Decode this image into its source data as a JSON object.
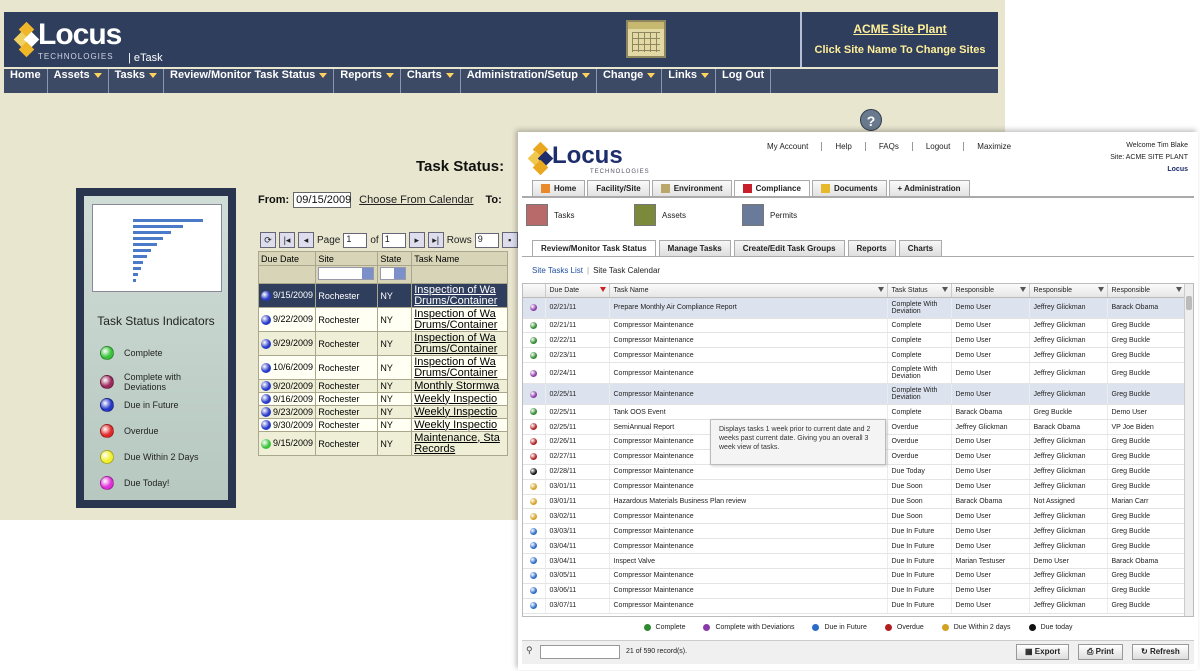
{
  "old_app": {
    "logo_text": "Locus",
    "logo_sub": "TECHNOLOGIES",
    "product": "| eTask",
    "site": {
      "name": "ACME Site Plant",
      "change_label": "Click Site Name To Change Sites"
    },
    "nav": [
      {
        "label": "Home",
        "dropdown": false
      },
      {
        "label": "Assets",
        "dropdown": true
      },
      {
        "label": "Tasks",
        "dropdown": true
      },
      {
        "label": "Review/Monitor Task Status",
        "dropdown": true
      },
      {
        "label": "Reports",
        "dropdown": true
      },
      {
        "label": "Charts",
        "dropdown": true
      },
      {
        "label": "Administration/Setup",
        "dropdown": true
      },
      {
        "label": "Change",
        "dropdown": true
      },
      {
        "label": "Links",
        "dropdown": true
      },
      {
        "label": "Log Out",
        "dropdown": false
      }
    ],
    "help_label": "?",
    "page_title": "Task Status:",
    "from_label": "From:",
    "from_value": "09/15/2009",
    "calendar_link": "Choose From Calendar",
    "to_label": "To:",
    "legend": {
      "title": "Task Status Indicators",
      "items": [
        {
          "label": "Complete",
          "color": "#39c23a"
        },
        {
          "label": "Complete with Deviations",
          "color": "#9c2a5c"
        },
        {
          "label": "Due in Future",
          "color": "#2638c8"
        },
        {
          "label": "Overdue",
          "color": "#e02a2a"
        },
        {
          "label": "Due Within 2 Days",
          "color": "#f0f02a"
        },
        {
          "label": "Due Today!",
          "color": "#e030d8"
        }
      ]
    },
    "pager": {
      "page_label": "Page",
      "page_value": "1",
      "of_label": "of",
      "of_value": "1",
      "rows_label": "Rows",
      "rows_value": "9"
    },
    "columns": [
      "Due Date",
      "Site",
      "State",
      "Task Name"
    ],
    "rows": [
      {
        "date": "9/15/2009",
        "site": "Rochester",
        "state": "NY",
        "task": [
          "Inspection of Wa",
          "Drums/Container"
        ],
        "color": "#2638c8"
      },
      {
        "date": "9/22/2009",
        "site": "Rochester",
        "state": "NY",
        "task": [
          "Inspection of Wa",
          "Drums/Container"
        ],
        "color": "#2638c8"
      },
      {
        "date": "9/29/2009",
        "site": "Rochester",
        "state": "NY",
        "task": [
          "Inspection of Wa",
          "Drums/Container"
        ],
        "color": "#2638c8"
      },
      {
        "date": "10/6/2009",
        "site": "Rochester",
        "state": "NY",
        "task": [
          "Inspection of Wa",
          "Drums/Container"
        ],
        "color": "#2638c8"
      },
      {
        "date": "9/20/2009",
        "site": "Rochester",
        "state": "NY",
        "task": [
          "Monthly Stormwa"
        ],
        "color": "#2638c8"
      },
      {
        "date": "9/16/2009",
        "site": "Rochester",
        "state": "NY",
        "task": [
          "Weekly Inspectio"
        ],
        "color": "#2638c8"
      },
      {
        "date": "9/23/2009",
        "site": "Rochester",
        "state": "NY",
        "task": [
          "Weekly Inspectio"
        ],
        "color": "#2638c8"
      },
      {
        "date": "9/30/2009",
        "site": "Rochester",
        "state": "NY",
        "task": [
          "Weekly Inspectio"
        ],
        "color": "#2638c8"
      },
      {
        "date": "9/15/2009",
        "site": "Rochester",
        "state": "NY",
        "task": [
          "Maintenance, Sta",
          "Records"
        ],
        "color": "#39c23a"
      }
    ]
  },
  "new_app": {
    "logo_text": "Locus",
    "logo_sub": "TECHNOLOGIES",
    "top_links": [
      "My Account",
      "Help",
      "FAQs",
      "Logout",
      "Maximize"
    ],
    "welcome": "Welcome Tim Blake",
    "site_line": "Site: ACME SITE PLANT",
    "corner_logo": "Locus",
    "main_tabs": [
      {
        "label": "Home",
        "color": "#e8892a"
      },
      {
        "label": "Facility/Site",
        "color": ""
      },
      {
        "label": "Environment",
        "color": "#b9a86a"
      },
      {
        "label": "Compliance",
        "color": "#c8202a"
      },
      {
        "label": "Documents",
        "color": "#e6b82a"
      },
      {
        "label": "+ Administration",
        "color": ""
      }
    ],
    "sub_icons": [
      {
        "label": "Tasks",
        "color": "#b86a6a"
      },
      {
        "label": "Assets",
        "color": "#7a8a3a"
      },
      {
        "label": "Permits",
        "color": "#6a7a9a"
      }
    ],
    "sub_tabs": [
      "Review/Monitor Task Status",
      "Manage Tasks",
      "Create/Edit Task Groups",
      "Reports",
      "Charts"
    ],
    "crumbs": [
      "Site Tasks List",
      "Site Task Calendar"
    ],
    "columns": [
      "Due Date",
      "Task Name",
      "Task Status",
      "Responsible",
      "Responsible",
      "Responsible"
    ],
    "rows": [
      {
        "date": "02/21/11",
        "task": "Prepare Monthly Air Compliance Report",
        "status": "Complete With Deviation",
        "r1": "Demo User",
        "r2": "Jeffrey Glickman",
        "r3": "Barack Obama",
        "color": "#8a3aa8",
        "tall": true,
        "hi": true
      },
      {
        "date": "02/21/11",
        "task": "Compressor Maintenance",
        "status": "Complete",
        "r1": "Demo User",
        "r2": "Jeffrey Glickman",
        "r3": "Greg Buckle",
        "color": "#2e8a2e"
      },
      {
        "date": "02/22/11",
        "task": "Compressor Maintenance",
        "status": "Complete",
        "r1": "Demo User",
        "r2": "Jeffrey Glickman",
        "r3": "Greg Buckle",
        "color": "#2e8a2e"
      },
      {
        "date": "02/23/11",
        "task": "Compressor Maintenance",
        "status": "Complete",
        "r1": "Demo User",
        "r2": "Jeffrey Glickman",
        "r3": "Greg Buckle",
        "color": "#2e8a2e"
      },
      {
        "date": "02/24/11",
        "task": "Compressor Maintenance",
        "status": "Complete With Deviation",
        "r1": "Demo User",
        "r2": "Jeffrey Glickman",
        "r3": "Greg Buckle",
        "color": "#8a3aa8",
        "tall": true
      },
      {
        "date": "02/25/11",
        "task": "Compressor Maintenance",
        "status": "Complete With Deviation",
        "r1": "Demo User",
        "r2": "Jeffrey Glickman",
        "r3": "Greg Buckle",
        "color": "#8a3aa8",
        "tall": true,
        "hi": true
      },
      {
        "date": "02/25/11",
        "task": "Tank OOS Event",
        "status": "Complete",
        "r1": "Barack Obama",
        "r2": "Greg Buckle",
        "r3": "Demo User",
        "color": "#2e8a2e"
      },
      {
        "date": "02/25/11",
        "task": "SemiAnnual Report",
        "status": "Overdue",
        "r1": "Jeffrey Glickman",
        "r2": "Barack Obama",
        "r3": "VP Joe Biden",
        "color": "#b02020"
      },
      {
        "date": "02/26/11",
        "task": "Compressor Maintenance",
        "status": "Overdue",
        "r1": "Demo User",
        "r2": "Jeffrey Glickman",
        "r3": "Greg Buckle",
        "color": "#b02020"
      },
      {
        "date": "02/27/11",
        "task": "Compressor Maintenance",
        "status": "Overdue",
        "r1": "Demo User",
        "r2": "Jeffrey Glickman",
        "r3": "Greg Buckle",
        "color": "#b02020"
      },
      {
        "date": "02/28/11",
        "task": "Compressor Maintenance",
        "status": "Due Today",
        "r1": "Demo User",
        "r2": "Jeffrey Glickman",
        "r3": "Greg Buckle",
        "color": "#111111"
      },
      {
        "date": "03/01/11",
        "task": "Compressor Maintenance",
        "status": "Due Soon",
        "r1": "Demo User",
        "r2": "Jeffrey Glickman",
        "r3": "Greg Buckle",
        "color": "#d4a020"
      },
      {
        "date": "03/01/11",
        "task": "Hazardous Materials Business Plan review",
        "status": "Due Soon",
        "r1": "Barack Obama",
        "r2": "Not Assigned",
        "r3": "Marian Carr",
        "color": "#d4a020"
      },
      {
        "date": "03/02/11",
        "task": "Compressor Maintenance",
        "status": "Due Soon",
        "r1": "Demo User",
        "r2": "Jeffrey Glickman",
        "r3": "Greg Buckle",
        "color": "#d4a020"
      },
      {
        "date": "03/03/11",
        "task": "Compressor Maintenance",
        "status": "Due In Future",
        "r1": "Demo User",
        "r2": "Jeffrey Glickman",
        "r3": "Greg Buckle",
        "color": "#2a6ac8"
      },
      {
        "date": "03/04/11",
        "task": "Compressor Maintenance",
        "status": "Due In Future",
        "r1": "Demo User",
        "r2": "Jeffrey Glickman",
        "r3": "Greg Buckle",
        "color": "#2a6ac8"
      },
      {
        "date": "03/04/11",
        "task": "Inspect Valve",
        "status": "Due In Future",
        "r1": "Marian Testuser",
        "r2": "Demo User",
        "r3": "Barack Obama",
        "color": "#2a6ac8"
      },
      {
        "date": "03/05/11",
        "task": "Compressor Maintenance",
        "status": "Due In Future",
        "r1": "Demo User",
        "r2": "Jeffrey Glickman",
        "r3": "Greg Buckle",
        "color": "#2a6ac8"
      },
      {
        "date": "03/06/11",
        "task": "Compressor Maintenance",
        "status": "Due In Future",
        "r1": "Demo User",
        "r2": "Jeffrey Glickman",
        "r3": "Greg Buckle",
        "color": "#2a6ac8"
      },
      {
        "date": "03/07/11",
        "task": "Compressor Maintenance",
        "status": "Due In Future",
        "r1": "Demo User",
        "r2": "Jeffrey Glickman",
        "r3": "Greg Buckle",
        "color": "#2a6ac8"
      }
    ],
    "tooltip": "Displays tasks 1 week prior to current date and 2 weeks past current date. Giving you an overall 3 week view of tasks.",
    "legend": [
      {
        "label": "Complete",
        "color": "#2e8a2e"
      },
      {
        "label": "Complete with Deviations",
        "color": "#8a3aa8"
      },
      {
        "label": "Due in Future",
        "color": "#2a6ac8"
      },
      {
        "label": "Overdue",
        "color": "#b02020"
      },
      {
        "label": "Due Within 2 days",
        "color": "#d4a020"
      },
      {
        "label": "Due today",
        "color": "#111111"
      }
    ],
    "record_count": "21 of 590 record(s).",
    "buttons": [
      "Export",
      "Print",
      "Refresh"
    ]
  }
}
